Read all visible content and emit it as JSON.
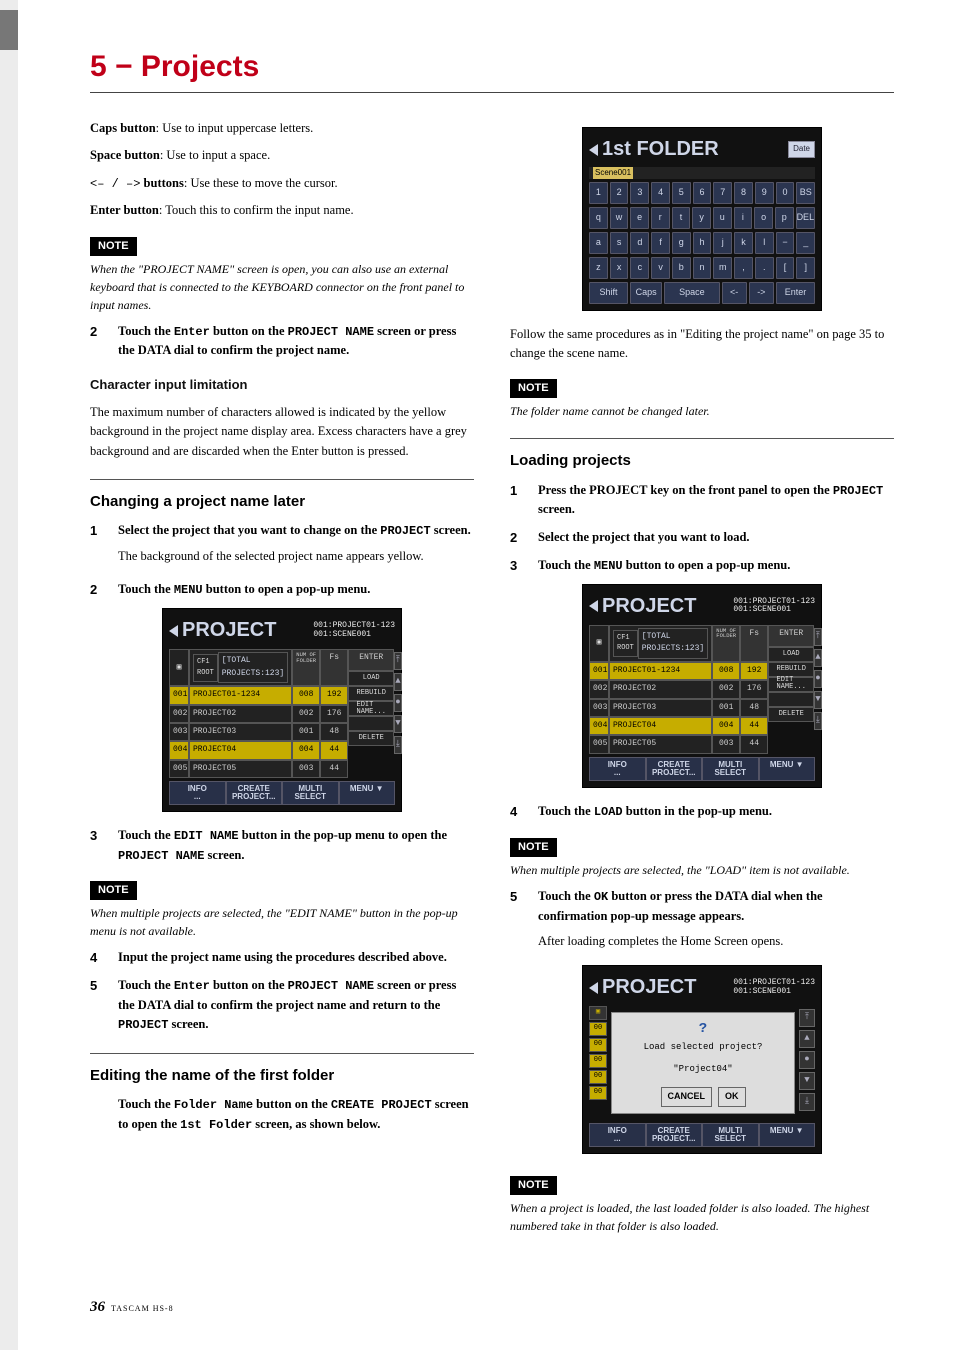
{
  "chapter": "5 − Projects",
  "leftCol": {
    "caps": [
      "Caps button",
      ": Use to input uppercase letters."
    ],
    "space": [
      "Space button",
      ": Use to input a space."
    ],
    "arrows": [
      "<– / –>",
      " buttons",
      ": Use these to move the cursor."
    ],
    "enter": [
      "Enter button",
      ": Touch this to confirm the input name."
    ],
    "note1": "When the \"PROJECT NAME\" screen is open, you can also use an external keyboard that is connected to the KEYBOARD connector on the front panel to input names.",
    "step2": {
      "num": "2",
      "parts": [
        "Touch the ",
        "Enter",
        " button on the ",
        "PROJECT NAME",
        " screen or press the DATA dial to confirm the project name."
      ]
    },
    "charInputHead": "Character input limitation",
    "charInputBody": "The maximum number of characters allowed is indicated by the yellow background in the project name display area. Excess characters have a grey background and are discarded when the Enter button is pressed.",
    "secA": "Changing a project name later",
    "a1": {
      "num": "1",
      "lead": "Select the project that you want to change on the ",
      "mono": "PROJECT",
      "tail": " screen.",
      "after": "The background of the selected project name appears yellow."
    },
    "a2": {
      "num": "2",
      "lead": "Touch the ",
      "mono": "MENU",
      "tail": " button to open a pop-up menu."
    },
    "lcdA": {
      "title": "PROJECT",
      "sub1": "001:PROJECT01-123",
      "sub2": "001:SCENE001",
      "root": "CF1 ROOT",
      "rootSub": "[TOTAL PROJECTS:123]",
      "heads": [
        "NUM\nOF\nFOLDER",
        "Fs",
        "ENTER"
      ],
      "rows": [
        {
          "idx": "001",
          "name": "PROJECT01-1234",
          "c1": "008",
          "c2": "192",
          "hl": true,
          "btn": "LOAD"
        },
        {
          "idx": "002",
          "name": "PROJECT02",
          "c1": "002",
          "c2": "176",
          "hl": false,
          "btn": "REBUILD"
        },
        {
          "idx": "003",
          "name": "PROJECT03",
          "c1": "001",
          "c2": "48",
          "hl": false,
          "btn": "EDIT\nNAME..."
        },
        {
          "idx": "004",
          "name": "PROJECT04",
          "c1": "004",
          "c2": "44",
          "hl": true,
          "btn": ""
        },
        {
          "idx": "005",
          "name": "PROJECT05",
          "c1": "003",
          "c2": "44",
          "hl": false,
          "btn": "DELETE"
        }
      ],
      "bottom": [
        "INFO\n...",
        "CREATE\nPROJECT...",
        "MULTI\nSELECT",
        "MENU"
      ]
    },
    "a3": {
      "num": "3",
      "lead": "Touch the ",
      "mono": "EDIT NAME",
      "mid": " button in the pop-up menu to open the ",
      "mono2": "PROJECT NAME",
      "tail": " screen."
    },
    "note2": "When multiple projects are selected, the \"EDIT NAME\" button in the pop-up menu is not available.",
    "a4": {
      "num": "4",
      "text": "Input the project name using the procedures described above."
    },
    "a5": {
      "num": "5",
      "parts": [
        "Touch the ",
        "Enter",
        " button on the ",
        "PROJECT NAME",
        " screen or press the DATA dial to confirm the project name and return to the ",
        "PROJECT",
        " screen."
      ]
    },
    "secB": "Editing the name of the first folder",
    "bBody": {
      "parts": [
        "Touch the ",
        "Folder Name",
        " button on the ",
        "CREATE PROJECT",
        " screen to open the ",
        "1st Folder",
        " screen, as shown below."
      ]
    }
  },
  "rightCol": {
    "kbd": {
      "title": "1st FOLDER",
      "date": "Date",
      "scene": "Scene001",
      "rows": [
        [
          "1",
          "2",
          "3",
          "4",
          "5",
          "6",
          "7",
          "8",
          "9",
          "0",
          "BS"
        ],
        [
          "q",
          "w",
          "e",
          "r",
          "t",
          "y",
          "u",
          "i",
          "o",
          "p",
          "DEL"
        ],
        [
          "a",
          "s",
          "d",
          "f",
          "g",
          "h",
          "j",
          "k",
          "l",
          "−",
          "_"
        ],
        [
          "z",
          "x",
          "c",
          "v",
          "b",
          "n",
          "m",
          ",",
          ".",
          "[",
          "]"
        ]
      ],
      "bottom": [
        "Shift",
        "Caps",
        "Space",
        "<-",
        "->",
        "Enter"
      ]
    },
    "intro": "Follow the same procedures as in \"Editing the project name\" on page 35 to change the scene name.",
    "note1": "The folder name cannot be changed later.",
    "secC": "Loading projects",
    "c1": {
      "num": "1",
      "lead": "Press the PROJECT key on the front panel to open the ",
      "mono": "PROJECT",
      "tail": " screen."
    },
    "c2": {
      "num": "2",
      "text": "Select the project that you want to load."
    },
    "c3": {
      "num": "3",
      "lead": "Touch the ",
      "mono": "MENU",
      "tail": " button to open a pop-up menu."
    },
    "lcdB": {
      "title": "PROJECT",
      "sub1": "001:PROJECT01-123",
      "sub2": "001:SCENE001",
      "root": "CF1 ROOT",
      "rootSub": "[TOTAL PROJECTS:123]",
      "heads": [
        "NUM\nOF\nFOLDER",
        "Fs",
        "ENTER"
      ],
      "rows": [
        {
          "idx": "001",
          "name": "PROJECT01-1234",
          "c1": "008",
          "c2": "192",
          "hl": true,
          "btn": "LOAD"
        },
        {
          "idx": "002",
          "name": "PROJECT02",
          "c1": "002",
          "c2": "176",
          "hl": false,
          "btn": "REBUILD"
        },
        {
          "idx": "003",
          "name": "PROJECT03",
          "c1": "001",
          "c2": "48",
          "hl": false,
          "btn": "EDIT\nNAME..."
        },
        {
          "idx": "004",
          "name": "PROJECT04",
          "c1": "004",
          "c2": "44",
          "hl": true,
          "btn": ""
        },
        {
          "idx": "005",
          "name": "PROJECT05",
          "c1": "003",
          "c2": "44",
          "hl": false,
          "btn": "DELETE"
        }
      ],
      "bottom": [
        "INFO\n...",
        "CREATE\nPROJECT...",
        "MULTI\nSELECT",
        "MENU"
      ]
    },
    "c4": {
      "num": "4",
      "lead": "Touch the ",
      "mono": "LOAD",
      "tail": " button in the pop-up menu."
    },
    "note2": "When multiple projects are selected, the \"LOAD\" item is not available.",
    "c5": {
      "num": "5",
      "lead": "Touch the ",
      "mono": "OK",
      "tail": " button or press the DATA dial when the confirmation pop-up message appears.",
      "after": "After loading completes the Home Screen opens."
    },
    "lcdC": {
      "title": "PROJECT",
      "sub1": "001:PROJECT01-123",
      "sub2": "001:SCENE001",
      "confirm": {
        "msg": "Load selected project?",
        "name": "\"Project04\"",
        "cancel": "CANCEL",
        "ok": "OK"
      },
      "bottom": [
        "INFO\n...",
        "CREATE\nPROJECT...",
        "MULTI\nSELECT",
        "MENU"
      ]
    },
    "note3": "When a project is loaded, the last loaded folder is also loaded. The highest numbered take in that folder is also loaded."
  },
  "footer": {
    "page": "36",
    "model": "TASCAM HS-8"
  }
}
